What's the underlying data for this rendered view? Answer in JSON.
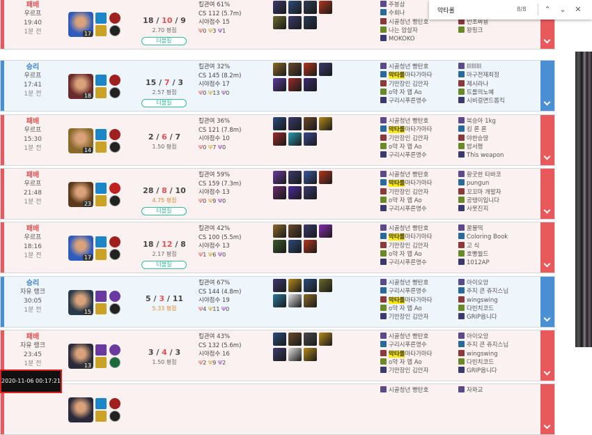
{
  "find": {
    "query": "막타롤",
    "count": "8/8",
    "prev_icon": "chevron-up-icon",
    "next_icon": "chevron-down-icon",
    "close_icon": "close-icon"
  },
  "timestamp": "2020-11-06 00:17:21",
  "matches": [
    {
      "result": "패배",
      "queue": "우르프",
      "duration": "19:40",
      "ago": "1분 전",
      "outcome": "loss",
      "level": "17",
      "champion_color": "#2f5bbd",
      "kills": "18",
      "deaths": "10",
      "assists": "9",
      "ratio": "2.70 평점",
      "badge": "더블킬",
      "kp": "킬관여 61%",
      "cs": "CS 112 (5.7m)",
      "vision": "시야점수 15",
      "objectives": [
        "0",
        "3",
        "1"
      ],
      "items": [
        "#3a3a6e",
        "#2a4c7a",
        "#2d3e56",
        "#b3371d",
        "#6b6b2e",
        "#3a3a6e",
        "#2a3a5a"
      ],
      "team1": [
        {
          "name": "주봉삼",
          "hl": false
        },
        {
          "name": "수회나",
          "hl": false
        },
        {
          "name": "시골청년 빵탄호",
          "hl": false
        },
        {
          "name": "나는 암살자",
          "hl": false
        },
        {
          "name": "MOKOKO",
          "hl": false
        }
      ],
      "team2": [
        {
          "name": "훌림제",
          "hl": false
        },
        {
          "name": "수줍은순대",
          "hl": false
        },
        {
          "name": "민초짜용",
          "hl": false
        },
        {
          "name": "왕핑크",
          "hl": false
        },
        {
          "name": "",
          "hl": false
        }
      ]
    },
    {
      "result": "승리",
      "queue": "우르프",
      "duration": "17:41",
      "ago": "1분 전",
      "outcome": "win",
      "level": "18",
      "champion_color": "#6a2a2a",
      "kills": "15",
      "deaths": "7",
      "assists": "3",
      "ratio": "2.57 평점",
      "badge": "더블킬",
      "kp": "킬관여 32%",
      "cs": "CS 145 (8.2m)",
      "vision": "시야점수 17",
      "objectives": [
        "0",
        "13",
        "0"
      ],
      "items": [
        "#8a6a2a",
        "#6b4a2a",
        "#b3371d",
        "#3a3a6e",
        "#5a3aa0",
        "#9a2a2a",
        "#3a2a6e"
      ],
      "team1": [
        {
          "name": "시골청년 빵탄호",
          "hl": false
        },
        {
          "name": "막타롤",
          "rest": "마타가마타",
          "hl": true
        },
        {
          "name": "기만장인 김안자",
          "hl": false
        },
        {
          "name": "o약 자 앱 Ao",
          "hl": false
        },
        {
          "name": "구리시푸른명수",
          "hl": false
        }
      ],
      "team2": [
        {
          "name": "lllllllll",
          "hl": false
        },
        {
          "name": "아구전재최정",
          "hl": false
        },
        {
          "name": "제시라나",
          "hl": false
        },
        {
          "name": "트롤의노예",
          "hl": false
        },
        {
          "name": "시비걸면드롭킥",
          "hl": false
        }
      ]
    },
    {
      "result": "패배",
      "queue": "우르프",
      "duration": "15:30",
      "ago": "1분 전",
      "outcome": "loss",
      "level": "14",
      "champion_color": "#8a6a2a",
      "kills": "2",
      "deaths": "6",
      "assists": "7",
      "ratio": "1.50 평점",
      "badge": "",
      "kp": "킬관여 36%",
      "cs": "CS 121 (7.8m)",
      "vision": "시야점수 10",
      "objectives": [
        "0",
        "7",
        "0"
      ],
      "items": [
        "#2a4c7a",
        "#3a3a6e",
        "#6b4a2a",
        "#b38a1d",
        "#9a2a2a",
        "#2a9ab3",
        "#3a4a8a"
      ],
      "team1": [
        {
          "name": "시골청년 빵탄호",
          "hl": false
        },
        {
          "name": "막타롤",
          "rest": "마타가마타",
          "hl": true
        },
        {
          "name": "기만장인 김안자",
          "hl": false
        },
        {
          "name": "o약 자 앱 Ao",
          "hl": false
        },
        {
          "name": "구리시푸른명수",
          "hl": false
        }
      ],
      "team2": [
        {
          "name": "북승아 1kg",
          "hl": false
        },
        {
          "name": "킹 론 론",
          "hl": false
        },
        {
          "name": "야한승땅",
          "hl": false
        },
        {
          "name": "밤서평",
          "hl": false
        },
        {
          "name": "This weapon",
          "hl": false
        }
      ]
    },
    {
      "result": "패배",
      "queue": "우르프",
      "duration": "21:48",
      "ago": "1분 전",
      "outcome": "loss",
      "level": "23",
      "champion_color": "#5a3a1a",
      "kills": "28",
      "deaths": "8",
      "assists": "10",
      "ratio": "4.75 평점",
      "ratio_hi": true,
      "badge": "더블킬",
      "kp": "킬관여 59%",
      "cs": "CS 159 (7.3m)",
      "vision": "시야점수 13",
      "objectives": [
        "0",
        "9",
        "0"
      ],
      "items": [
        "#6a3aa0",
        "#3a3a6e",
        "#3a5aa0",
        "#b3371d",
        "#6a2a6e",
        "#4a2aa0",
        "#3a3a6e"
      ],
      "team1": [
        {
          "name": "시골청년 빵탄호",
          "hl": false
        },
        {
          "name": "막타롤",
          "rest": "마타가마타",
          "hl": true
        },
        {
          "name": "기만장인 김안자",
          "hl": false
        },
        {
          "name": "o약 자 앱 Ao",
          "hl": false
        },
        {
          "name": "구리시푸른명수",
          "hl": false
        }
      ],
      "team2": [
        {
          "name": "황굿한 타바코",
          "hl": false
        },
        {
          "name": "pungun",
          "hl": false
        },
        {
          "name": "꼬꼬마 개발자",
          "hl": false
        },
        {
          "name": "공탱이입니다",
          "hl": false
        },
        {
          "name": "사뭇진지",
          "hl": false
        }
      ]
    },
    {
      "result": "패배",
      "queue": "우르프",
      "duration": "18:16",
      "ago": "1분 전",
      "outcome": "loss",
      "level": "17",
      "champion_color": "#2f5bbd",
      "kills": "18",
      "deaths": "12",
      "assists": "8",
      "ratio": "2.17 평점",
      "badge": "더블킬",
      "kp": "킬관여 42%",
      "cs": "CS 100 (5.5m)",
      "vision": "시야점수 13",
      "objectives": [
        "1",
        "6",
        "0"
      ],
      "items": [
        "#8a6a2a",
        "#6b4a2a",
        "#3a3a6e",
        "#8a2ab3",
        "#3a5a2a",
        "#2a4c7a",
        "#b3371d"
      ],
      "team1": [
        {
          "name": "시골청년 빵탄호",
          "hl": false
        },
        {
          "name": "막타롤",
          "rest": "마타가마타",
          "hl": true
        },
        {
          "name": "기만장인 김안자",
          "hl": false
        },
        {
          "name": "o약 자 앱 Ao",
          "hl": false
        },
        {
          "name": "구리시푸른명수",
          "hl": false
        }
      ],
      "team2": [
        {
          "name": "꿀물떡",
          "hl": false
        },
        {
          "name": "Coloring Book",
          "hl": false
        },
        {
          "name": "고 식",
          "hl": false
        },
        {
          "name": "호빵월드",
          "hl": false
        },
        {
          "name": "1012AP",
          "hl": false
        }
      ]
    },
    {
      "result": "승리",
      "queue": "자유 랭크",
      "duration": "30:05",
      "ago": "1분 전",
      "outcome": "win",
      "level": "15",
      "champion_color": "#2a3a4a",
      "kills": "5",
      "deaths": "3",
      "assists": "11",
      "ratio": "5.33 평점",
      "ratio_hi": true,
      "badge": "",
      "kp": "킬관여 67%",
      "cs": "CS 144 (4.8m)",
      "vision": "시야점수 19",
      "objectives": [
        "4",
        "11",
        "0"
      ],
      "items": [
        "#3a3a6e",
        "#b38a1d",
        "#2a4c7a",
        "#6a6a2a",
        "#2a7a9a",
        "#e0e0e0",
        "#8a6a2a"
      ],
      "team1": [
        {
          "name": "시골청년 빵탄호",
          "hl": false
        },
        {
          "name": "구리시푸른명수",
          "hl": false
        },
        {
          "name": "막타롤",
          "rest": "마타가마타",
          "hl": true
        },
        {
          "name": "o약 자 앱 Ao",
          "hl": false
        },
        {
          "name": "기만장인 김안자",
          "hl": false
        }
      ],
      "team2": [
        {
          "name": "아이오앙",
          "hl": false
        },
        {
          "name": "주지 큰 쥬지스님",
          "hl": false
        },
        {
          "name": "wingswing",
          "hl": false
        },
        {
          "name": "다빈치코드",
          "hl": false
        },
        {
          "name": "GRIP옵니다",
          "hl": false
        }
      ]
    },
    {
      "result": "패배",
      "queue": "자유 랭크",
      "duration": "23:45",
      "ago": "1분 전",
      "outcome": "loss",
      "level": "13",
      "champion_color": "#2a2a3a",
      "kills": "3",
      "deaths": "4",
      "assists": "3",
      "ratio": "1.50 평점",
      "badge": "",
      "kp": "킬관여 43%",
      "cs": "CS 132 (5.6m)",
      "vision": "시야점수 16",
      "objectives": [
        "2",
        "9",
        "2"
      ],
      "items": [
        "#2a4c7a",
        "#6b4a2a",
        "#4a4a4a",
        "#b38a1d",
        "#3a3a6e",
        "#e0e0e0",
        "#b38a1d"
      ],
      "team1": [
        {
          "name": "시골청년 빵탄호",
          "hl": false
        },
        {
          "name": "구리시푸른명수",
          "hl": false
        },
        {
          "name": "막타롤",
          "rest": "마타가마타",
          "hl": true
        },
        {
          "name": "o약 자 앱 Ao",
          "hl": false
        },
        {
          "name": "기만장인 김안자",
          "hl": false
        }
      ],
      "team2": [
        {
          "name": "아이오앙",
          "hl": false
        },
        {
          "name": "주지 큰 쥬지스님",
          "hl": false
        },
        {
          "name": "wingswing",
          "hl": false
        },
        {
          "name": "다빈치코드",
          "hl": false
        },
        {
          "name": "GRIP옵니다",
          "hl": false
        }
      ]
    },
    {
      "result": "",
      "queue": "",
      "duration": "",
      "ago": "",
      "outcome": "loss",
      "level": "",
      "champion_color": "#2a2a3a",
      "kills": "",
      "deaths": "",
      "assists": "",
      "ratio": "",
      "badge": "",
      "kp": "",
      "cs": "",
      "vision": "",
      "objectives": [
        "",
        "",
        ""
      ],
      "items": [],
      "team1": [
        {
          "name": "시골청년 빵탄호",
          "hl": false
        }
      ],
      "team2": [
        {
          "name": "자와교",
          "hl": false
        }
      ]
    }
  ]
}
